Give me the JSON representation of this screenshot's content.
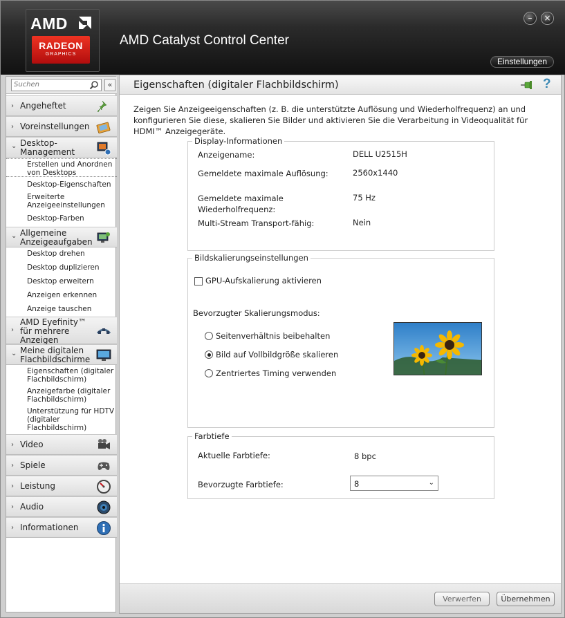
{
  "header": {
    "logo_brand": "AMD",
    "logo_product": "RADEON",
    "logo_sub": "GRAPHICS",
    "app_title": "AMD Catalyst Control Center",
    "settings_label": "Einstellungen",
    "minimize_symbol": "–",
    "close_symbol": "×"
  },
  "sidebar": {
    "search_placeholder": "Suchen",
    "collapse_symbol": "«",
    "items": [
      {
        "label": "Angeheftet",
        "chevron": "›",
        "icon": "pin-icon"
      },
      {
        "label": "Voreinstellungen",
        "chevron": "›",
        "icon": "presets-icon"
      },
      {
        "label": "Desktop-\nManagement",
        "chevron": "⌄",
        "icon": "desktop-management-icon"
      },
      {
        "label": "Allgemeine\nAnzeigeaufgaben",
        "chevron": "⌄",
        "icon": "display-tasks-icon"
      },
      {
        "label": "AMD Eyefinity™\nfür mehrere\nAnzeigen",
        "chevron": "›",
        "icon": "eyefinity-icon"
      },
      {
        "label": "Meine digitalen\nFlachbildschirme",
        "chevron": "⌄",
        "icon": "flat-panel-icon"
      },
      {
        "label": "Video",
        "chevron": "›",
        "icon": "video-camera-icon"
      },
      {
        "label": "Spiele",
        "chevron": "›",
        "icon": "gamepad-icon"
      },
      {
        "label": "Leistung",
        "chevron": "›",
        "icon": "gauge-icon"
      },
      {
        "label": "Audio",
        "chevron": "›",
        "icon": "speaker-icon"
      },
      {
        "label": "Informationen",
        "chevron": "›",
        "icon": "info-icon"
      }
    ],
    "desktop_sub": [
      "Erstellen und Anordnen\nvon Desktops",
      "Desktop-Eigenschaften",
      "Erweiterte\nAnzeigeeinstellungen",
      "Desktop-Farben"
    ],
    "display_sub": [
      "Desktop drehen",
      "Desktop duplizieren",
      "Desktop erweitern",
      "Anzeigen erkennen",
      "Anzeige tauschen"
    ],
    "panel_sub": [
      "Eigenschaften (digitaler\nFlachbildschirm)",
      "Anzeigefarbe (digitaler\nFlachbildschirm)",
      "Unterstützung für HDTV\n(digitaler\nFlachbildschirm)"
    ]
  },
  "page": {
    "title": "Eigenschaften (digitaler Flachbildschirm)",
    "help_symbol": "?",
    "description": "Zeigen Sie Anzeigeeigenschaften (z. B. die unterstützte Auflösung und Wiederholfrequenz) an und konfigurieren Sie diese, skalieren Sie Bilder und aktivieren Sie die Verarbeitung in Videoqualität für HDMI™ Anzeigegeräte.",
    "display_info": {
      "title": "Display-Informationen",
      "rows": [
        {
          "label": "Anzeigename:",
          "value": "DELL U2515H"
        },
        {
          "label": "Gemeldete maximale Auflösung:",
          "value": "2560x1440"
        },
        {
          "label": "Gemeldete maximale\nWiederholfrequenz:",
          "value": "75 Hz"
        },
        {
          "label": "Multi-Stream Transport-fähig:",
          "value": "Nein"
        }
      ]
    },
    "scaling": {
      "title": "Bildskalierungseinstellungen",
      "gpu_scaling_label": "GPU-Aufskalierung aktivieren",
      "gpu_scaling_checked": false,
      "mode_label": "Bevorzugter Skalierungsmodus:",
      "options": [
        "Seitenverhältnis beibehalten",
        "Bild auf Vollbildgröße skalieren",
        "Zentriertes Timing verwenden"
      ],
      "selected_index": 1
    },
    "color_depth": {
      "title": "Farbtiefe",
      "current_label": "Aktuelle Farbtiefe:",
      "current_value": "8 bpc",
      "preferred_label": "Bevorzugte Farbtiefe:",
      "preferred_value": "8"
    },
    "footer": {
      "discard_label": "Verwerfen",
      "apply_label": "Übernehmen"
    }
  },
  "colors": {
    "amd_red": "#c4141a",
    "help_blue": "#3d8ab5",
    "sky_blue": "#5aa9e0"
  }
}
